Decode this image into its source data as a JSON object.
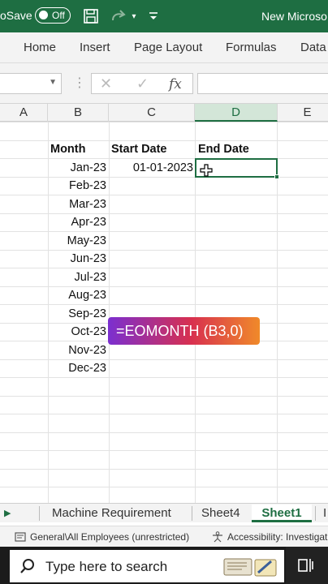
{
  "window": {
    "autosave_label": "oSave",
    "autosave_state": "Off",
    "title": "New Microso"
  },
  "ribbon": {
    "tabs": [
      "Home",
      "Insert",
      "Page Layout",
      "Formulas",
      "Data"
    ]
  },
  "formula_bar": {
    "name_box": "",
    "formula": ""
  },
  "columns": [
    "A",
    "B",
    "C",
    "D",
    "E"
  ],
  "selected_column": "D",
  "table": {
    "headers": {
      "month": "Month",
      "start": "Start Date",
      "end": "End Date"
    },
    "months": [
      "Jan-23",
      "Feb-23",
      "Mar-23",
      "Apr-23",
      "May-23",
      "Jun-23",
      "Jul-23",
      "Aug-23",
      "Sep-23",
      "Oct-23",
      "Nov-23",
      "Dec-23"
    ],
    "start_date": "01-01-2023"
  },
  "overlay": {
    "formula_hint": "=EOMONTH (B3,0)"
  },
  "sheets": {
    "tabs": [
      "Machine Requirement",
      "Sheet4",
      "Sheet1",
      "I"
    ],
    "active": "Sheet1"
  },
  "status": {
    "sensitivity": "General\\All Employees (unrestricted)",
    "accessibility": "Accessibility: Investigat"
  },
  "taskbar": {
    "search_placeholder": "Type here to search"
  },
  "colors": {
    "excel_green": "#1e6e42",
    "selected_col_bg": "#d3e6d8"
  }
}
